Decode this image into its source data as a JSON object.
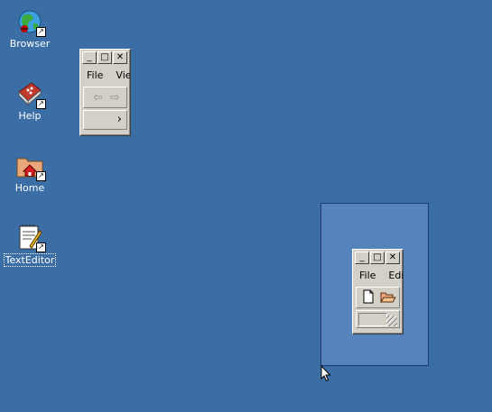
{
  "desktop": {
    "icons": [
      {
        "label": "Browser"
      },
      {
        "label": "Help"
      },
      {
        "label": "Home"
      },
      {
        "label": "TextEditor"
      }
    ]
  },
  "browser_window": {
    "menu": [
      "File",
      "Vie"
    ],
    "buttons": {
      "minimize": "_",
      "maximize": "□",
      "close": "✕"
    },
    "back_glyph": "⇦",
    "forward_glyph": "⇨",
    "more_glyph": "›"
  },
  "editor_window": {
    "menu": [
      "File",
      "Edi"
    ],
    "buttons": {
      "minimize": "_",
      "maximize": "□",
      "close": "✕"
    }
  },
  "colors": {
    "desktop": "#3a6ea5",
    "selection": "#5583bb",
    "window": "#d4d0c8"
  }
}
